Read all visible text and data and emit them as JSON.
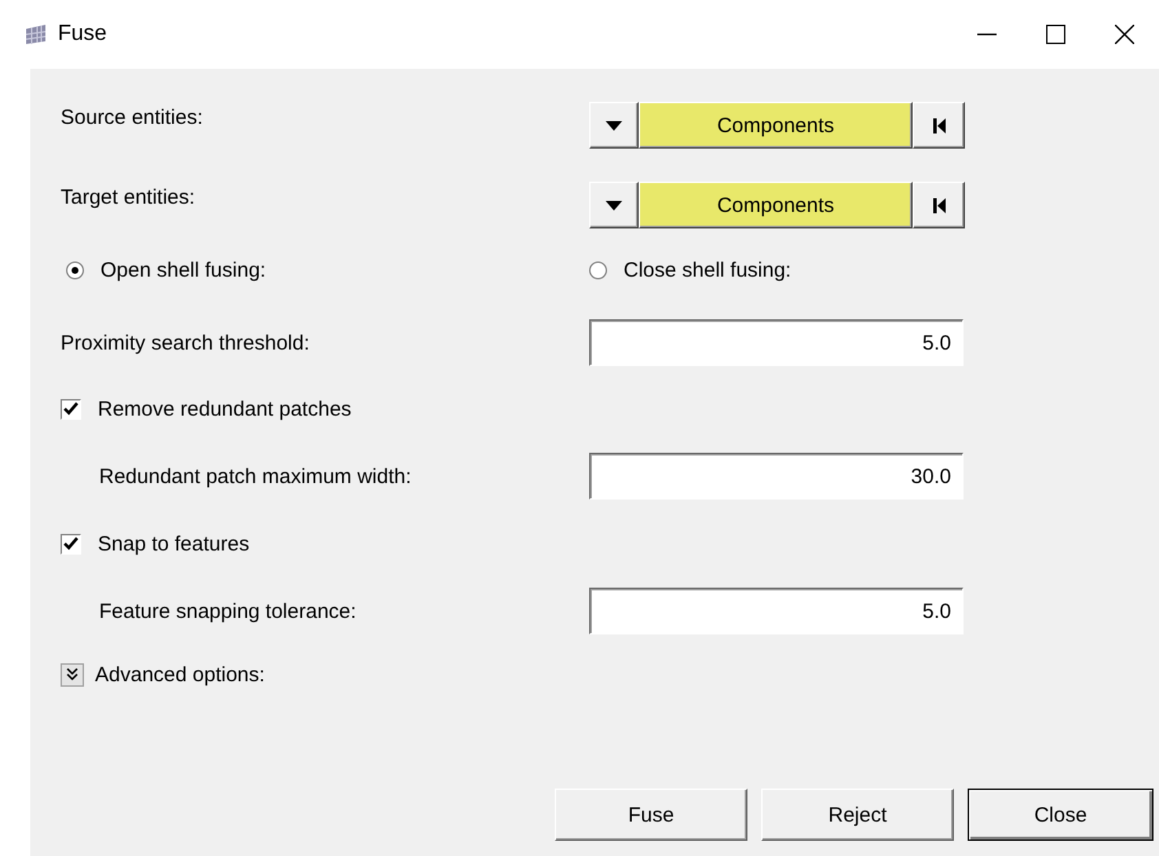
{
  "window": {
    "title": "Fuse"
  },
  "selectors": [
    {
      "label": "Source entities:",
      "type": "Components"
    },
    {
      "label": "Target entities:",
      "type": "Components"
    }
  ],
  "fusing_modes": [
    {
      "label": "Open shell fusing:",
      "selected": true
    },
    {
      "label": "Close shell fusing:",
      "selected": false
    }
  ],
  "settings": [
    {
      "kind": "field",
      "label": "Proximity search threshold:",
      "value": "5.0"
    },
    {
      "kind": "checkbox",
      "label": "Remove redundant patches",
      "checked": true
    },
    {
      "kind": "subfield",
      "label": "Redundant patch maximum width:",
      "value": "30.0"
    },
    {
      "kind": "checkbox",
      "label": "Snap to features",
      "checked": true
    },
    {
      "kind": "subfield",
      "label": "Feature snapping tolerance:",
      "value": "5.0"
    },
    {
      "kind": "expander",
      "label": "Advanced options:",
      "expanded": false
    }
  ],
  "buttons": [
    {
      "label": "Fuse",
      "default": false
    },
    {
      "label": "Reject",
      "default": false
    },
    {
      "label": "Close",
      "default": true
    }
  ]
}
